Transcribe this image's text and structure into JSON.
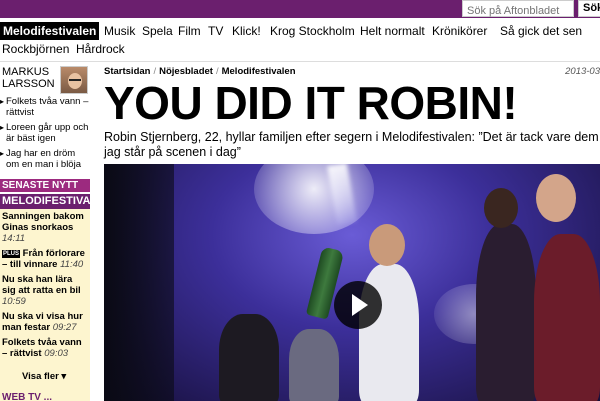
{
  "search": {
    "placeholder": "Sök på Aftonbladet",
    "button_label": "Sök"
  },
  "nav": {
    "items": [
      "Melodifestivalen",
      "Musik",
      "Spela",
      "Film",
      "TV",
      "Klick!",
      "Krog Stockholm",
      "Helt normalt",
      "Krönikörer",
      "Så gick det sen",
      "Rockbjörnen",
      "Hårdrock"
    ]
  },
  "sidebar": {
    "author": "MARKUS LARSSON",
    "column_links": [
      "Folkets tvåa vann – rättvist",
      "Loreen går upp och är bäst igen",
      "Jag har en dröm om en man i blöja"
    ],
    "senaste_label": "SENASTE NYTT",
    "news_box_title": "MELODIFESTIVALEN",
    "news": [
      {
        "title": "Sanningen bakom Ginas snorkaos",
        "time": "14:11",
        "plus": false
      },
      {
        "title": "Från förlorare – till vinnare",
        "time": "11:40",
        "plus": true,
        "plus_label": "PLUS"
      },
      {
        "title": "Nu ska han lära sig att ratta en bil",
        "time": "10:59",
        "plus": false
      },
      {
        "title": "Nu ska vi visa hur man festar",
        "time": "09:27",
        "plus": false
      },
      {
        "title": "Folkets tvåa vann – rättvist",
        "time": "09:03",
        "plus": false
      }
    ],
    "visa_fler": "Visa fler ▾",
    "bottom_label": "WEB TV   ..."
  },
  "article": {
    "breadcrumb": [
      "Startsidan",
      "Nöjesbladet",
      "Melodifestivalen"
    ],
    "date": "2013-03",
    "headline": "YOU DID IT ROBIN!",
    "lead": "Robin Stjernberg, 22, hyllar familjen efter segern i Melodifestivalen: ”Det är tack vare dem jag står på scenen i dag”"
  },
  "colors": {
    "brand_purple": "#6b1f6e",
    "accent_magenta": "#9c2a7f",
    "news_bg": "#fdf5cf"
  }
}
